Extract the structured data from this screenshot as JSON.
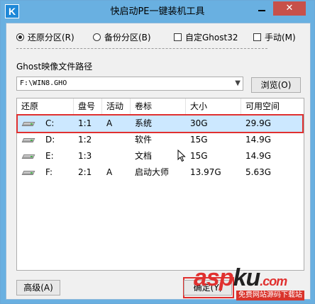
{
  "window": {
    "title": "快启动PE一键装机工具",
    "app_icon_letter": "K",
    "close_glyph": "✕"
  },
  "options": {
    "restore": "还原分区(R)",
    "backup": "备份分区(B)",
    "custom_ghost": "自定Ghost32",
    "manual": "手动(M)",
    "restore_selected": true
  },
  "ghost_path": {
    "label": "Ghost映像文件路径",
    "value": "F:\\WIN8.GHO",
    "browse": "浏览(O)"
  },
  "table": {
    "columns": [
      "还原",
      "盘号",
      "活动",
      "卷标",
      "大小",
      "可用空间"
    ],
    "rows": [
      {
        "drive": "C:",
        "disk": "1:1",
        "active": "A",
        "label": "系统",
        "size": "30G",
        "free": "29.9G",
        "selected": true
      },
      {
        "drive": "D:",
        "disk": "1:2",
        "active": "",
        "label": "软件",
        "size": "15G",
        "free": "14.9G",
        "selected": false
      },
      {
        "drive": "E:",
        "disk": "1:3",
        "active": "",
        "label": "文档",
        "size": "15G",
        "free": "14.9G",
        "selected": false
      },
      {
        "drive": "F:",
        "disk": "2:1",
        "active": "A",
        "label": "启动大师",
        "size": "13.97G",
        "free": "5.63G",
        "selected": false
      }
    ]
  },
  "buttons": {
    "advanced": "高级(A)",
    "confirm": "确定(Y)"
  },
  "watermark": {
    "main": "asp",
    "accent": "ku",
    "domain": ".com",
    "sub": "免费网站源码下载站"
  },
  "colors": {
    "title_bar": "#69b0e1",
    "highlight_outline": "#e0302f",
    "selected_row": "#cce8ff"
  }
}
